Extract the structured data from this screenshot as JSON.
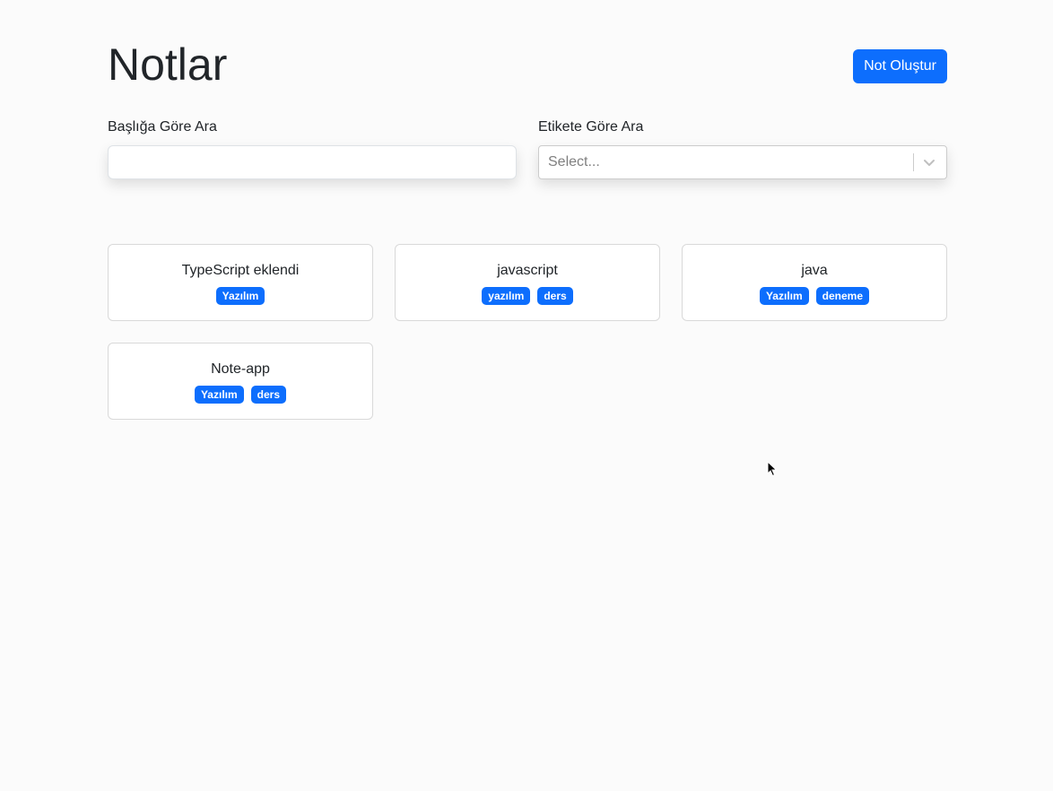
{
  "header": {
    "title": "Notlar",
    "create_button_label": "Not Oluştur"
  },
  "filters": {
    "title_search_label": "Başlığa Göre Ara",
    "title_search_value": "",
    "tag_search_label": "Etikete Göre Ara",
    "tag_search_placeholder": "Select..."
  },
  "notes": [
    {
      "title": "TypeScript eklendi",
      "tags": [
        "Yazılım"
      ]
    },
    {
      "title": "javascript",
      "tags": [
        "yazılım",
        "ders"
      ]
    },
    {
      "title": "java",
      "tags": [
        "Yazılım",
        "deneme"
      ]
    },
    {
      "title": "Note-app",
      "tags": [
        "Yazılım",
        "ders"
      ]
    }
  ],
  "colors": {
    "primary": "#0d6efd",
    "background": "#fbfbfb",
    "card_border": "#d9d9d9"
  },
  "icons": {
    "select_indicator": "chevron-down-icon",
    "pointer": "mouse-cursor-icon"
  }
}
